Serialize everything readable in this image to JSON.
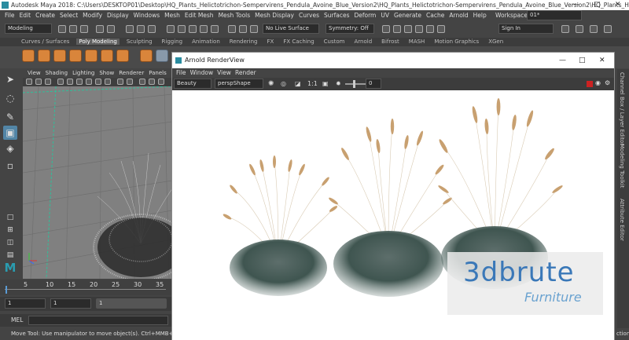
{
  "window": {
    "title": "Autodesk Maya 2018: C:\\Users\\DESKTOP01\\Desktop\\HQ_Plants_Helictotrichon-Sempervirens_Pendula_Avoine_Blue_Version2\\HQ_Plants_Helictotrichon-Sempervirens_Pendula_Avoine_Blue_Version2\\HQ_Plants_Helictotrichon-S..."
  },
  "menubar": {
    "items": [
      "File",
      "Edit",
      "Create",
      "Select",
      "Modify",
      "Display",
      "Windows",
      "Mesh",
      "Edit Mesh",
      "Mesh Tools",
      "Mesh Display",
      "Curves",
      "Surfaces",
      "Deform",
      "UV",
      "Generate",
      "Cache",
      "Arnold",
      "Help"
    ],
    "workspace_label": "Workspace :",
    "workspace_value": "01*"
  },
  "statusline": {
    "mode": "Modeling",
    "live_surface": "No Live Surface",
    "symmetry": "Symmetry: Off",
    "sign_in": "Sign In"
  },
  "shelf": {
    "tabs": [
      "Curves / Surfaces",
      "Poly Modeling",
      "Sculpting",
      "Rigging",
      "Animation",
      "Rendering",
      "FX",
      "FX Caching",
      "Custom",
      "Arnold",
      "Bifrost",
      "MASH",
      "Motion Graphics",
      "XGen"
    ],
    "active_tab": "Poly Modeling"
  },
  "viewport": {
    "menu": [
      "View",
      "Shading",
      "Lighting",
      "Show",
      "Renderer",
      "Panels"
    ]
  },
  "timeslider": {
    "ticks": [
      "5",
      "10",
      "15",
      "20",
      "25",
      "30",
      "35"
    ],
    "current_frame": "1",
    "start_frame": "1",
    "range_start": "1"
  },
  "mel": {
    "label": "MEL"
  },
  "helpline": {
    "text": "Move Tool: Use manipulator to move object(s). Ctrl+MMB+drag to move com",
    "right_text": "ction a"
  },
  "right_strip": {
    "labels": [
      "Channel Box / Layer Editor",
      "Modeling Toolkit",
      "Attribute Editor"
    ]
  },
  "renderview": {
    "title": "Arnold RenderView",
    "menu": [
      "File",
      "Window",
      "View",
      "Render"
    ],
    "aov": "Beauty",
    "camera": "perspShape",
    "ratio": "1:1",
    "exposure": "0",
    "colors": {
      "stop": "#cc2222"
    }
  },
  "watermark": {
    "brand": "3dbrute",
    "sub": "Furniture"
  },
  "colors": {
    "accent": "#2a8ca0",
    "shelf_icon": "#d9853b",
    "grass": "#3f5550",
    "seed": "#c8a070"
  }
}
